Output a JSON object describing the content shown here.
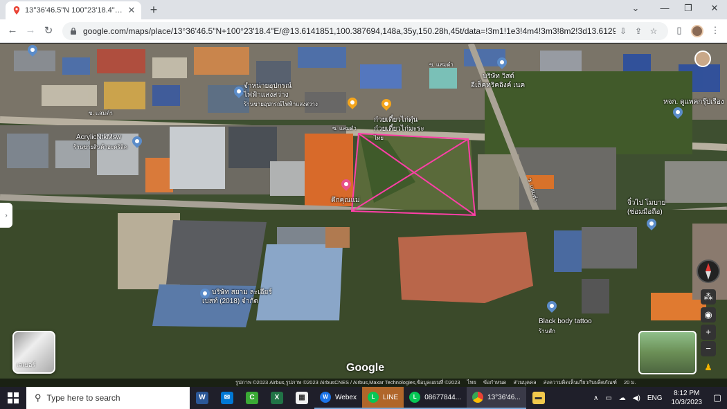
{
  "browser": {
    "tab_title": "13°36'46.5\"N 100°23'18.4\"E - Go",
    "url": "google.com/maps/place/13°36'46.5\"N+100°23'18.4\"E/@13.6141851,100.387694,148a,35y,150.28h,45t/data=!3m1!1e3!4m4!3m3!8m2!3d13.612917!4..."
  },
  "map": {
    "labels": [
      {
        "text": "ซ. แสมดำ"
      },
      {
        "text": "บริษัท วิสต์"
      },
      {
        "text": "อีเล็คทริคอิงค์ เนค"
      },
      {
        "text": "จำหน่ายอุปกรณ์"
      },
      {
        "text": "ไฟฟ้าแสงสว่าง"
      },
      {
        "text": "ร้านขายอุปกรณ์ไฟฟ้าแสงสว่าง"
      },
      {
        "text": "ซ. แสมดำ"
      },
      {
        "text": "ซ. แสมดำ"
      },
      {
        "text": "ก๋วยเตี๋ยวไก่ตุ๋น"
      },
      {
        "text": "ก๋วยเตี๋ยวไก่มะระ"
      },
      {
        "text": "ไทย"
      },
      {
        "text": "AcrylicNtkMsw"
      },
      {
        "text": "ร้านขายสินค้าอะคริลิค"
      },
      {
        "text": "ตึกคุณแม่"
      },
      {
        "text": "ซ. แสมดำ"
      },
      {
        "text": "หจก. ดูแพคกรุ๊ปเรือง"
      },
      {
        "text": "จิ๋วไป โมบาย"
      },
      {
        "text": "(ซ่อมมือถือ)"
      },
      {
        "text": "บริษัท สยาม ละเอียร์"
      },
      {
        "text": "เบสท์ (2018) จำกัด"
      },
      {
        "text": "Black body tattoo"
      },
      {
        "text": "ร้านสัก"
      }
    ],
    "google_logo": "Google",
    "attribution": [
      "รูปภาพ ©2023 Airbus,รูปภาพ ©2023 AirbusCNES / Airbus,Maxar Technologies,ข้อมูลแผนที่ ©2023",
      "ไทย",
      "ข้อกำหนด",
      "ส่วนบุคคล",
      "ส่งความคิดเห็นเกี่ยวกับผลิตภัณฑ์",
      "20 ม."
    ],
    "layers_label": "เลเยอร์",
    "icons": [
      "map-pin-icon",
      "food-pin-icon",
      "shop-pin-icon",
      "compass-icon",
      "zoom-in-icon",
      "zoom-out-icon",
      "pegman-icon",
      "layers-icon"
    ]
  },
  "taskbar": {
    "search_placeholder": "Type here to search",
    "items": [
      {
        "label": "Webex"
      },
      {
        "label": "LINE"
      },
      {
        "label": "08677844..."
      },
      {
        "label": "13°36'46..."
      }
    ],
    "lang": "ENG",
    "time": "8:12 PM",
    "date": "10/3/2023"
  }
}
